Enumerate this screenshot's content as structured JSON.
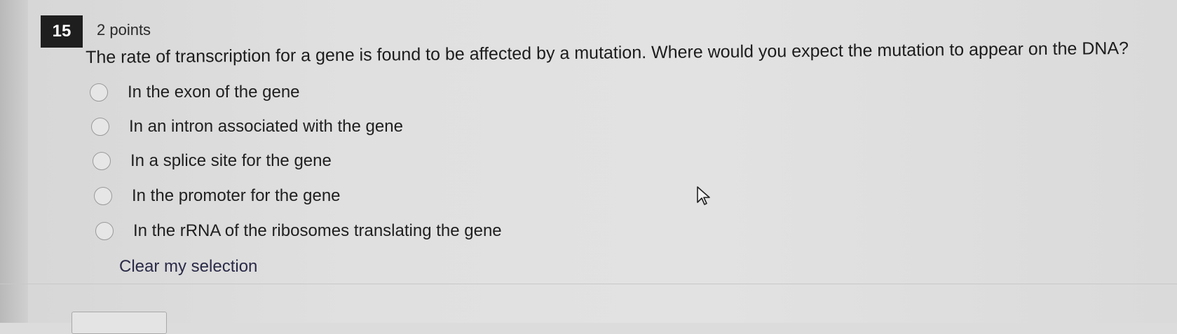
{
  "question": {
    "number": "15",
    "points": "2 points",
    "text": "The rate of transcription for a gene is found to be affected by a mutation. Where would you expect the mutation to appear on the DNA?"
  },
  "options": [
    {
      "label": "In the exon of the gene",
      "selected": false
    },
    {
      "label": "In an intron associated with the gene",
      "selected": false
    },
    {
      "label": "In a splice site for the gene",
      "selected": false
    },
    {
      "label": "In the promoter for the gene",
      "selected": false
    },
    {
      "label": "In the rRNA of the ribosomes translating the gene",
      "selected": false
    }
  ],
  "clear_selection_label": "Clear my selection",
  "icons": {
    "cursor": "mouse-pointer-icon"
  },
  "colors": {
    "number_badge_bg": "#1e1e1e",
    "link": "#2a2a48"
  }
}
